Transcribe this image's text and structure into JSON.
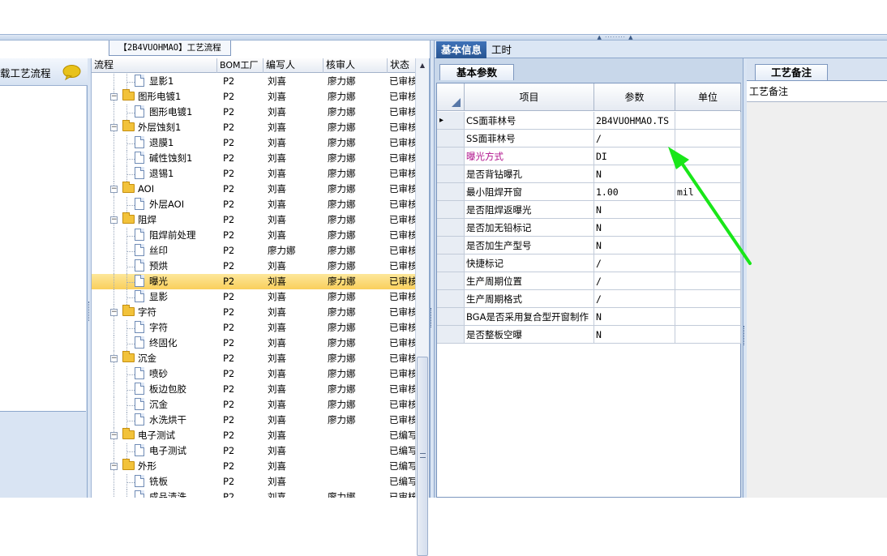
{
  "title_tab": "【2B4VUOHMAO】工艺流程",
  "left_panel": {
    "header": "载工艺流程"
  },
  "tree": {
    "columns": [
      "流程",
      "BOM工厂",
      "编写人",
      "核审人",
      "状态"
    ],
    "rows": [
      {
        "name": "显影1",
        "level": 1,
        "folder": false,
        "bom": "P2",
        "writer": "刘喜",
        "reviewer": "廖力娜",
        "status": "已审核"
      },
      {
        "name": "图形电镀1",
        "level": 0,
        "folder": true,
        "bom": "P2",
        "writer": "刘喜",
        "reviewer": "廖力娜",
        "status": "已审核"
      },
      {
        "name": "图形电镀1",
        "level": 1,
        "folder": false,
        "bom": "P2",
        "writer": "刘喜",
        "reviewer": "廖力娜",
        "status": "已审核"
      },
      {
        "name": "外层蚀刻1",
        "level": 0,
        "folder": true,
        "bom": "P2",
        "writer": "刘喜",
        "reviewer": "廖力娜",
        "status": "已审核"
      },
      {
        "name": "退膜1",
        "level": 1,
        "folder": false,
        "bom": "P2",
        "writer": "刘喜",
        "reviewer": "廖力娜",
        "status": "已审核"
      },
      {
        "name": "碱性蚀刻1",
        "level": 1,
        "folder": false,
        "bom": "P2",
        "writer": "刘喜",
        "reviewer": "廖力娜",
        "status": "已审核"
      },
      {
        "name": "退锡1",
        "level": 1,
        "folder": false,
        "bom": "P2",
        "writer": "刘喜",
        "reviewer": "廖力娜",
        "status": "已审核"
      },
      {
        "name": "AOI",
        "level": 0,
        "folder": true,
        "bom": "P2",
        "writer": "刘喜",
        "reviewer": "廖力娜",
        "status": "已审核"
      },
      {
        "name": "外层AOI",
        "level": 1,
        "folder": false,
        "bom": "P2",
        "writer": "刘喜",
        "reviewer": "廖力娜",
        "status": "已审核"
      },
      {
        "name": "阻焊",
        "level": 0,
        "folder": true,
        "bom": "P2",
        "writer": "刘喜",
        "reviewer": "廖力娜",
        "status": "已审核"
      },
      {
        "name": "阻焊前处理",
        "level": 1,
        "folder": false,
        "bom": "P2",
        "writer": "刘喜",
        "reviewer": "廖力娜",
        "status": "已审核"
      },
      {
        "name": "丝印",
        "level": 1,
        "folder": false,
        "bom": "P2",
        "writer": "廖力娜",
        "reviewer": "廖力娜",
        "status": "已审核"
      },
      {
        "name": "预烘",
        "level": 1,
        "folder": false,
        "bom": "P2",
        "writer": "刘喜",
        "reviewer": "廖力娜",
        "status": "已审核"
      },
      {
        "name": "曝光",
        "level": 1,
        "folder": false,
        "bom": "P2",
        "writer": "刘喜",
        "reviewer": "廖力娜",
        "status": "已审核",
        "selected": true
      },
      {
        "name": "显影",
        "level": 1,
        "folder": false,
        "bom": "P2",
        "writer": "刘喜",
        "reviewer": "廖力娜",
        "status": "已审核"
      },
      {
        "name": "字符",
        "level": 0,
        "folder": true,
        "bom": "P2",
        "writer": "刘喜",
        "reviewer": "廖力娜",
        "status": "已审核"
      },
      {
        "name": "字符",
        "level": 1,
        "folder": false,
        "bom": "P2",
        "writer": "刘喜",
        "reviewer": "廖力娜",
        "status": "已审核"
      },
      {
        "name": "终固化",
        "level": 1,
        "folder": false,
        "bom": "P2",
        "writer": "刘喜",
        "reviewer": "廖力娜",
        "status": "已审核"
      },
      {
        "name": "沉金",
        "level": 0,
        "folder": true,
        "bom": "P2",
        "writer": "刘喜",
        "reviewer": "廖力娜",
        "status": "已审核"
      },
      {
        "name": "喷砂",
        "level": 1,
        "folder": false,
        "bom": "P2",
        "writer": "刘喜",
        "reviewer": "廖力娜",
        "status": "已审核"
      },
      {
        "name": "板边包胶",
        "level": 1,
        "folder": false,
        "bom": "P2",
        "writer": "刘喜",
        "reviewer": "廖力娜",
        "status": "已审核"
      },
      {
        "name": "沉金",
        "level": 1,
        "folder": false,
        "bom": "P2",
        "writer": "刘喜",
        "reviewer": "廖力娜",
        "status": "已审核"
      },
      {
        "name": "水洗烘干",
        "level": 1,
        "folder": false,
        "bom": "P2",
        "writer": "刘喜",
        "reviewer": "廖力娜",
        "status": "已审核"
      },
      {
        "name": "电子测试",
        "level": 0,
        "folder": true,
        "bom": "P2",
        "writer": "刘喜",
        "reviewer": "",
        "status": "已编写"
      },
      {
        "name": "电子测试",
        "level": 1,
        "folder": false,
        "bom": "P2",
        "writer": "刘喜",
        "reviewer": "",
        "status": "已编写"
      },
      {
        "name": "外形",
        "level": 0,
        "folder": true,
        "bom": "P2",
        "writer": "刘喜",
        "reviewer": "",
        "status": "已编写"
      },
      {
        "name": "铣板",
        "level": 1,
        "folder": false,
        "bom": "P2",
        "writer": "刘喜",
        "reviewer": "",
        "status": "已编写"
      },
      {
        "name": "成品清洗",
        "level": 1,
        "folder": false,
        "bom": "P2",
        "writer": "刘喜",
        "reviewer": "廖力娜",
        "status": "已审核"
      }
    ]
  },
  "right_tabs": [
    "基本信息",
    "工时"
  ],
  "params": {
    "tab": "基本参数",
    "columns": [
      "项目",
      "参数",
      "单位"
    ],
    "rows": [
      {
        "item": "CS面菲林号",
        "value": "2B4VUOHMAO.TS",
        "unit": "",
        "current": true
      },
      {
        "item": "SS面菲林号",
        "value": "/",
        "unit": ""
      },
      {
        "item": "曝光方式",
        "value": "DI",
        "unit": "",
        "highlight": true
      },
      {
        "item": "是否背钻曝孔",
        "value": "N",
        "unit": ""
      },
      {
        "item": "最小阻焊开窗",
        "value": "1.00",
        "unit": "mil"
      },
      {
        "item": "是否阻焊返曝光",
        "value": "N",
        "unit": ""
      },
      {
        "item": "是否加无铅标记",
        "value": "N",
        "unit": ""
      },
      {
        "item": "是否加生产型号",
        "value": "N",
        "unit": ""
      },
      {
        "item": "快捷标记",
        "value": "/",
        "unit": ""
      },
      {
        "item": "生产周期位置",
        "value": "/",
        "unit": ""
      },
      {
        "item": "生产周期格式",
        "value": "/",
        "unit": ""
      },
      {
        "item": "BGA是否采用复合型开窗制作",
        "value": "N",
        "unit": ""
      },
      {
        "item": "是否整板空曝",
        "value": "N",
        "unit": ""
      }
    ]
  },
  "remark": {
    "tab": "工艺备注",
    "label": "工艺备注"
  },
  "colors": {
    "highlight_text": "#b0138d",
    "arrow": "#19e619",
    "tab_active": "#2f61a6",
    "selected_row": "#fbd86a"
  }
}
